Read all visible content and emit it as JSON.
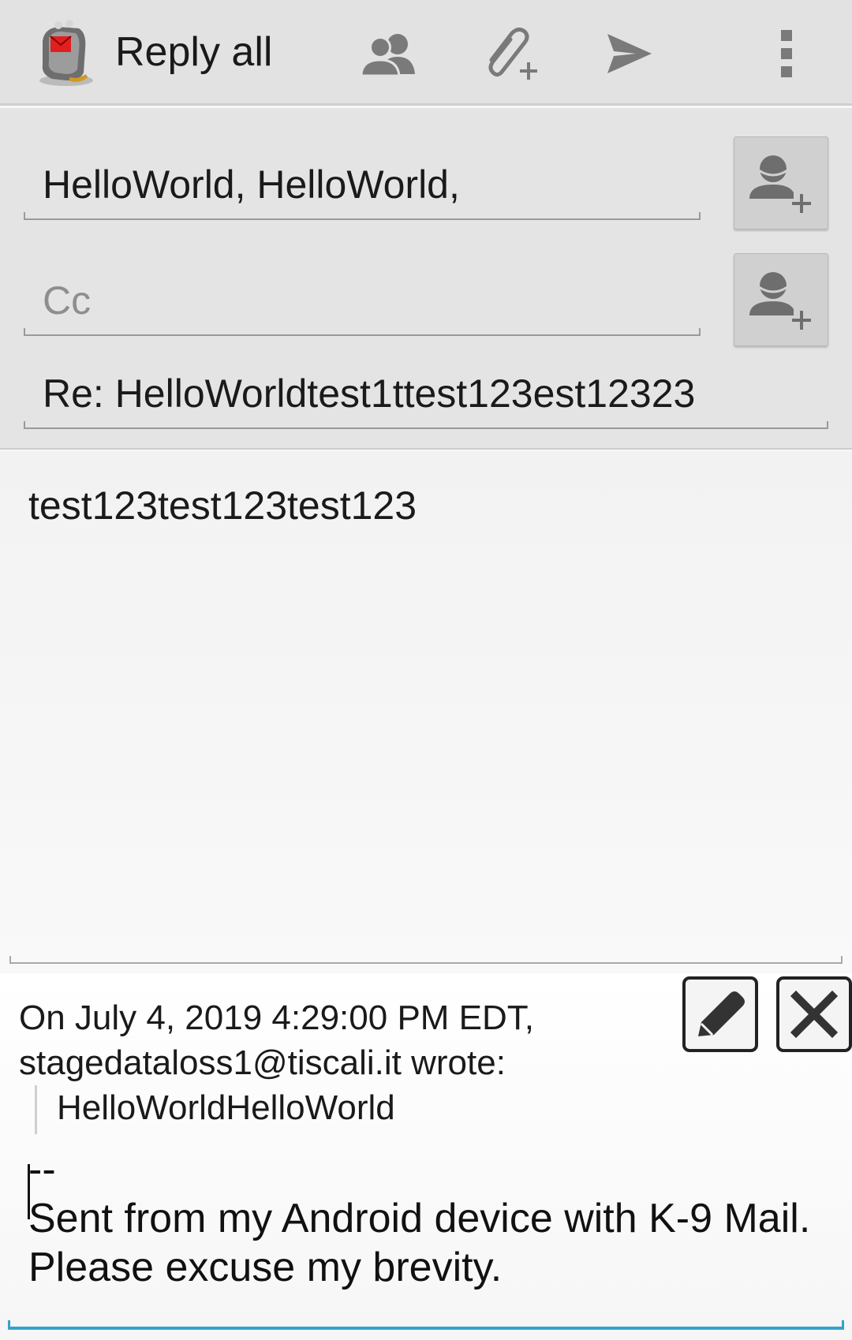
{
  "toolbar": {
    "title": "Reply all",
    "icons": [
      "app-logo-icon",
      "contacts-icon",
      "attach-icon",
      "send-icon",
      "overflow-menu-icon"
    ]
  },
  "header": {
    "to_value": "HelloWorld, HelloWorld,",
    "cc_placeholder": "Cc",
    "subject_value": "Re: HelloWorldtest1ttest123est12323"
  },
  "body": {
    "text": "test123test123test123"
  },
  "quote": {
    "header_line1": "On July 4, 2019 4:29:00 PM EDT,",
    "header_line2": "stagedataloss1@tiscali.it wrote:",
    "quoted_text": "HelloWorldHelloWorld"
  },
  "signature": {
    "separator": "--",
    "text": "Sent from my Android device with K-9 Mail. Please excuse my brevity."
  },
  "colors": {
    "accent": "#33a3cc",
    "toolbar_bg": "#e2e2e2"
  }
}
